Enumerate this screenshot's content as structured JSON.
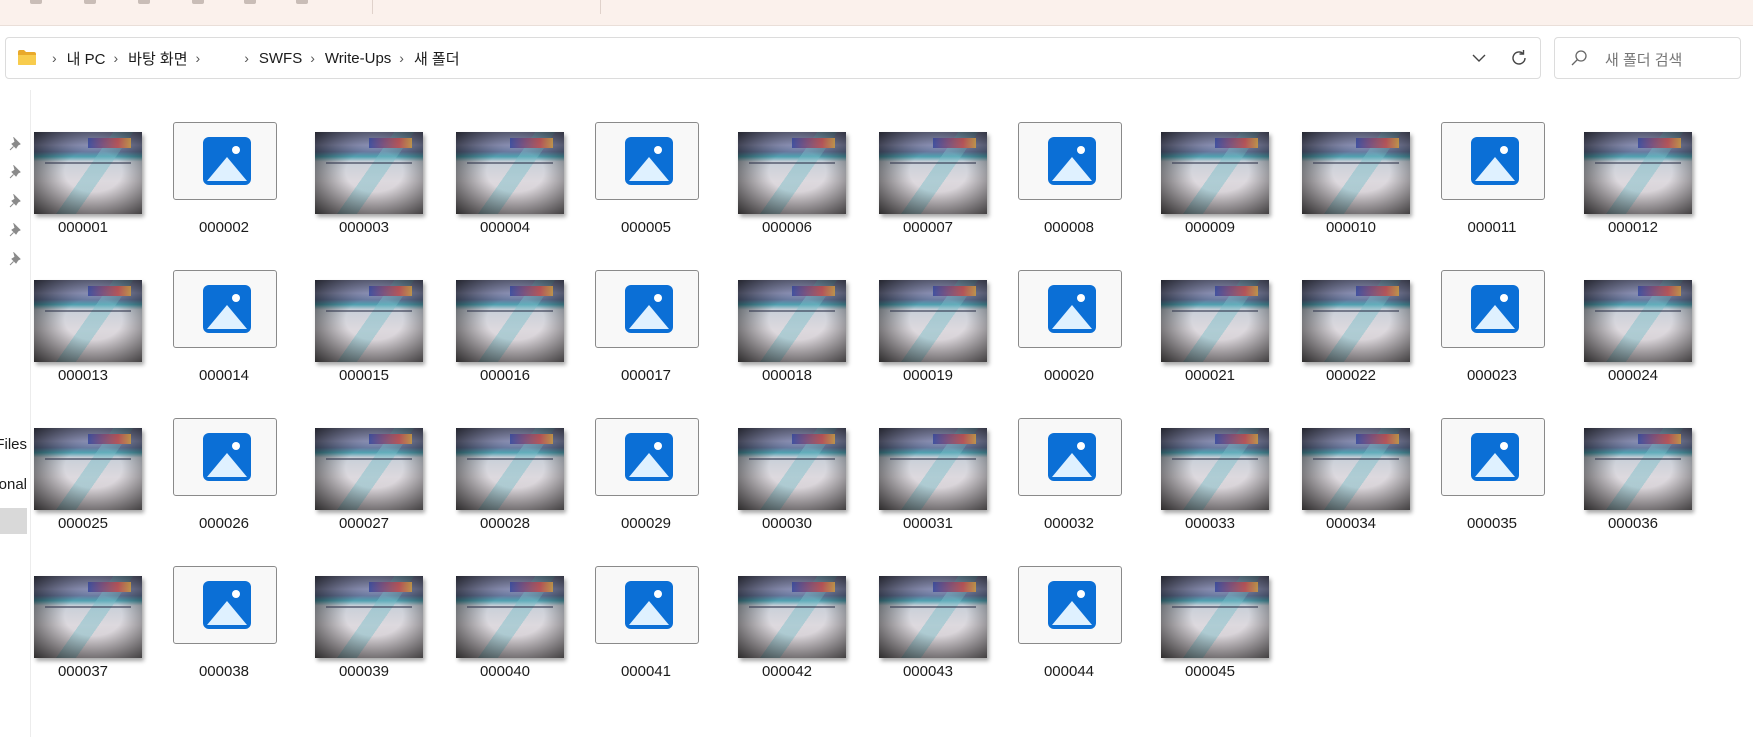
{
  "window": {
    "ribbon_note": ""
  },
  "address_bar": {
    "icons": [
      "folder-icon",
      "chevron-down-icon",
      "refresh-icon"
    ],
    "breadcrumbs": [
      "내 PC",
      "바탕 화면",
      "",
      "SWFS",
      "Write-Ups",
      "새 폴더"
    ]
  },
  "search": {
    "placeholder": "새 폴더 검색",
    "icon": "search-icon"
  },
  "nav_pane": {
    "pin_icon": "pin-icon",
    "partial_labels": [
      "Files",
      "onal"
    ]
  },
  "files": [
    {
      "name": "000001",
      "kind": "photo"
    },
    {
      "name": "000002",
      "kind": "generic"
    },
    {
      "name": "000003",
      "kind": "photo"
    },
    {
      "name": "000004",
      "kind": "photo"
    },
    {
      "name": "000005",
      "kind": "generic"
    },
    {
      "name": "000006",
      "kind": "photo"
    },
    {
      "name": "000007",
      "kind": "photo"
    },
    {
      "name": "000008",
      "kind": "generic"
    },
    {
      "name": "000009",
      "kind": "photo"
    },
    {
      "name": "000010",
      "kind": "photo"
    },
    {
      "name": "000011",
      "kind": "generic"
    },
    {
      "name": "000012",
      "kind": "photo"
    },
    {
      "name": "000013",
      "kind": "photo"
    },
    {
      "name": "000014",
      "kind": "generic"
    },
    {
      "name": "000015",
      "kind": "photo"
    },
    {
      "name": "000016",
      "kind": "photo"
    },
    {
      "name": "000017",
      "kind": "generic"
    },
    {
      "name": "000018",
      "kind": "photo"
    },
    {
      "name": "000019",
      "kind": "photo"
    },
    {
      "name": "000020",
      "kind": "generic"
    },
    {
      "name": "000021",
      "kind": "photo"
    },
    {
      "name": "000022",
      "kind": "photo"
    },
    {
      "name": "000023",
      "kind": "generic"
    },
    {
      "name": "000024",
      "kind": "photo"
    },
    {
      "name": "000025",
      "kind": "photo"
    },
    {
      "name": "000026",
      "kind": "generic"
    },
    {
      "name": "000027",
      "kind": "photo"
    },
    {
      "name": "000028",
      "kind": "photo"
    },
    {
      "name": "000029",
      "kind": "generic"
    },
    {
      "name": "000030",
      "kind": "photo"
    },
    {
      "name": "000031",
      "kind": "photo"
    },
    {
      "name": "000032",
      "kind": "generic"
    },
    {
      "name": "000033",
      "kind": "photo"
    },
    {
      "name": "000034",
      "kind": "photo"
    },
    {
      "name": "000035",
      "kind": "generic"
    },
    {
      "name": "000036",
      "kind": "photo"
    },
    {
      "name": "000037",
      "kind": "photo"
    },
    {
      "name": "000038",
      "kind": "generic"
    },
    {
      "name": "000039",
      "kind": "photo"
    },
    {
      "name": "000040",
      "kind": "photo"
    },
    {
      "name": "000041",
      "kind": "generic"
    },
    {
      "name": "000042",
      "kind": "photo"
    },
    {
      "name": "000043",
      "kind": "photo"
    },
    {
      "name": "000044",
      "kind": "generic"
    },
    {
      "name": "000045",
      "kind": "photo"
    }
  ],
  "colors": {
    "accent": "#0b6fd6",
    "ribbon_bg": "#fbf1ec",
    "folder_yellow": "#f6c445"
  }
}
